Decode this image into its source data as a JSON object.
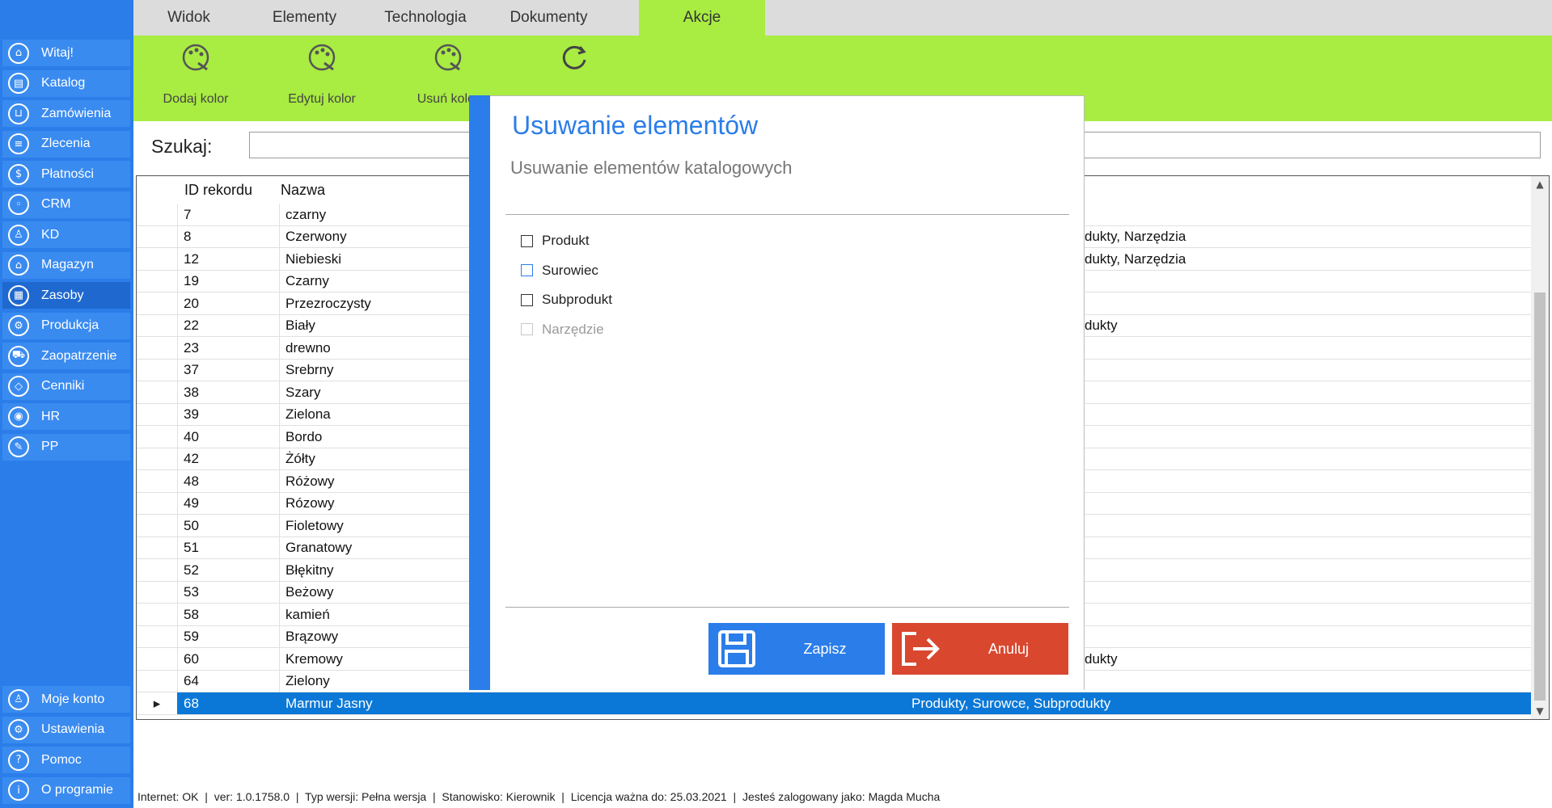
{
  "sidebar": {
    "items": [
      {
        "label": "Witaj!",
        "icon": "home-icon",
        "glyph": "⌂"
      },
      {
        "label": "Katalog",
        "icon": "book-icon",
        "glyph": "▤"
      },
      {
        "label": "Zamówienia",
        "icon": "cart-icon",
        "glyph": "⊔"
      },
      {
        "label": "Zlecenia",
        "icon": "list-icon",
        "glyph": "≡"
      },
      {
        "label": "Płatności",
        "icon": "dollar-icon",
        "glyph": "$"
      },
      {
        "label": "CRM",
        "icon": "crm-icon",
        "glyph": "◦"
      },
      {
        "label": "KD",
        "icon": "person-icon",
        "glyph": "♙"
      },
      {
        "label": "Magazyn",
        "icon": "warehouse-icon",
        "glyph": "⌂"
      },
      {
        "label": "Zasoby",
        "icon": "resources-icon",
        "glyph": "▦"
      },
      {
        "label": "Produkcja",
        "icon": "production-icon",
        "glyph": "⚙"
      },
      {
        "label": "Zaopatrzenie",
        "icon": "truck-icon",
        "glyph": "⛟"
      },
      {
        "label": "Cenniki",
        "icon": "tag-icon",
        "glyph": "◇"
      },
      {
        "label": "HR",
        "icon": "hr-icon",
        "glyph": "◉"
      },
      {
        "label": "PP",
        "icon": "pp-icon",
        "glyph": "✎"
      }
    ],
    "active_index": 8,
    "bottom_items": [
      {
        "label": "Moje konto",
        "icon": "account-icon",
        "glyph": "♙"
      },
      {
        "label": "Ustawienia",
        "icon": "settings-icon",
        "glyph": "⚙"
      },
      {
        "label": "Pomoc",
        "icon": "help-icon",
        "glyph": "?"
      },
      {
        "label": "O programie",
        "icon": "info-icon",
        "glyph": "i"
      }
    ]
  },
  "tabs": [
    "Widok",
    "Elementy",
    "Technologia",
    "Dokumenty",
    "Akcje"
  ],
  "active_tab": 4,
  "ribbon": [
    {
      "label": "Dodaj kolor",
      "icon": "add-color-icon"
    },
    {
      "label": "Edytuj kolor",
      "icon": "edit-color-icon"
    },
    {
      "label": "Usuń kolor",
      "icon": "delete-color-icon"
    },
    {
      "label": "",
      "icon": "refresh-icon"
    }
  ],
  "search": {
    "label": "Szukaj:",
    "value": ""
  },
  "grid": {
    "columns": [
      "ID rekordu",
      "Nazwa"
    ],
    "rows": [
      {
        "id": "7",
        "name": "czarny",
        "types": ""
      },
      {
        "id": "8",
        "name": "Czerwony",
        "types": "dukty, Narzędzia"
      },
      {
        "id": "12",
        "name": "Niebieski",
        "types": "dukty, Narzędzia"
      },
      {
        "id": "19",
        "name": "Czarny",
        "types": ""
      },
      {
        "id": "20",
        "name": "Przezroczysty",
        "types": ""
      },
      {
        "id": "22",
        "name": "Biały",
        "types": "dukty"
      },
      {
        "id": "23",
        "name": "drewno",
        "types": ""
      },
      {
        "id": "37",
        "name": "Srebrny",
        "types": ""
      },
      {
        "id": "38",
        "name": "Szary",
        "types": ""
      },
      {
        "id": "39",
        "name": "Zielona",
        "types": ""
      },
      {
        "id": "40",
        "name": "Bordo",
        "types": ""
      },
      {
        "id": "42",
        "name": "Żółty",
        "types": ""
      },
      {
        "id": "48",
        "name": "Różowy",
        "types": ""
      },
      {
        "id": "49",
        "name": "Rózowy",
        "types": ""
      },
      {
        "id": "50",
        "name": "Fioletowy",
        "types": ""
      },
      {
        "id": "51",
        "name": "Granatowy",
        "types": ""
      },
      {
        "id": "52",
        "name": "Błękitny",
        "types": ""
      },
      {
        "id": "53",
        "name": "Beżowy",
        "types": ""
      },
      {
        "id": "58",
        "name": "kamień",
        "types": ""
      },
      {
        "id": "59",
        "name": "Brązowy",
        "types": ""
      },
      {
        "id": "60",
        "name": "Kremowy",
        "types": "dukty"
      },
      {
        "id": "64",
        "name": "Zielony",
        "types": ""
      },
      {
        "id": "68",
        "name": "Marmur Jasny",
        "types": "Produkty, Surowce, Subprodukty"
      }
    ],
    "selected_index": 22
  },
  "dialog": {
    "title": "Usuwanie elementów",
    "subtitle": "Usuwanie elementów katalogowych",
    "options": [
      {
        "label": "Produkt",
        "checked": false,
        "disabled": false,
        "hover": false
      },
      {
        "label": "Surowiec",
        "checked": false,
        "disabled": false,
        "hover": true
      },
      {
        "label": "Subprodukt",
        "checked": false,
        "disabled": false,
        "hover": false
      },
      {
        "label": "Narzędzie",
        "checked": false,
        "disabled": true,
        "hover": false
      }
    ],
    "save_label": "Zapisz",
    "cancel_label": "Anuluj",
    "save_color": "#2b7de9",
    "cancel_color": "#d9472f"
  },
  "status": {
    "internet": "Internet: OK",
    "version": "ver: 1.0.1758.0",
    "edition": "Typ wersji: Pełna wersja",
    "station": "Stanowisko: Kierownik",
    "license": "Licencja ważna do: 25.03.2021",
    "user": "Jesteś zalogowany jako: Magda Mucha"
  },
  "colors": {
    "sidebar": "#2b7de9",
    "ribbon": "#a9ec42",
    "selected_row": "#0b78d7"
  }
}
